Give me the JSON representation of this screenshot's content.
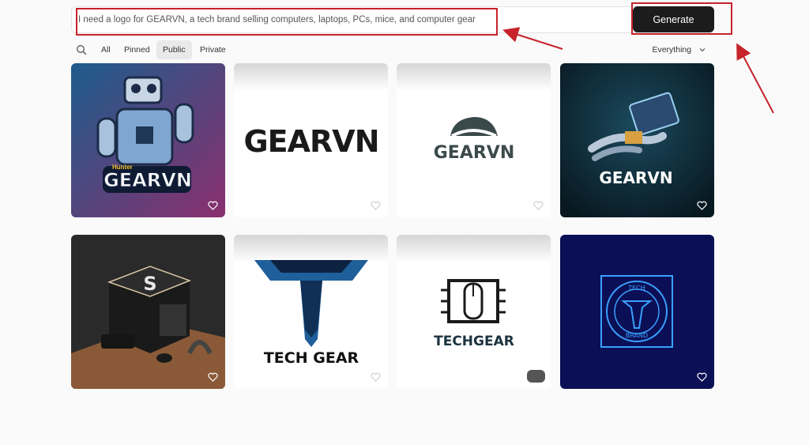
{
  "prompt": {
    "value": "I need a logo for GEARVN, a tech brand selling computers, laptops, PCs, mice, and computer gear",
    "generate_label": "Generate"
  },
  "filters": {
    "tabs": [
      {
        "label": "All",
        "active": false
      },
      {
        "label": "Pinned",
        "active": false
      },
      {
        "label": "Public",
        "active": true
      },
      {
        "label": "Private",
        "active": false
      }
    ],
    "scope_label": "Everything"
  },
  "gallery": [
    {
      "text": "GEARVN",
      "subtext": "Hunter",
      "style": "robot-mascot",
      "bg": "#6a3a8a"
    },
    {
      "text": "GEARVN",
      "style": "wordmark",
      "bg": "#ffffff"
    },
    {
      "text": "GEARVN",
      "style": "mouse-wordmark",
      "bg": "#ffffff"
    },
    {
      "text": "GEARVN",
      "style": "robot-hand",
      "bg": "#0f2a3a"
    },
    {
      "text": "S",
      "style": "3d-cube-pc",
      "bg": "#3a2a22"
    },
    {
      "text": "TECH GEAR",
      "style": "tg-emblem",
      "bg": "#ffffff"
    },
    {
      "text": "TECHGEAR",
      "style": "circuit-mouse",
      "bg": "#ffffff"
    },
    {
      "text": "TECH",
      "subtext": "BRAND",
      "style": "blue-seal",
      "bg": "#0b0f55"
    }
  ],
  "colors": {
    "accent": "#1c1c1c",
    "annotation": "#c6232b"
  }
}
